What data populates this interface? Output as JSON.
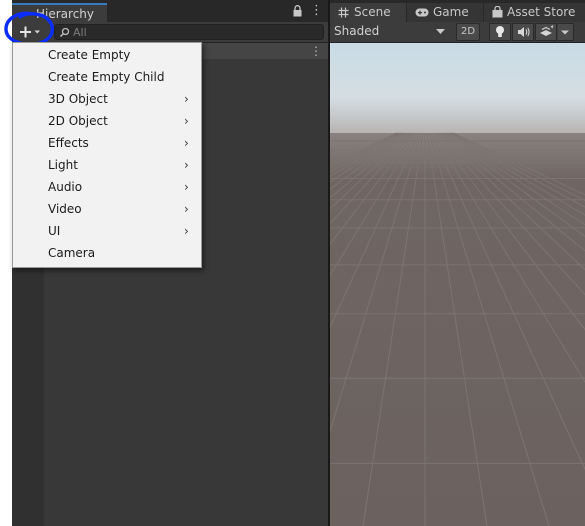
{
  "hierarchy": {
    "tab_label": "Hierarchy",
    "search_placeholder": "All"
  },
  "create_menu": {
    "items": [
      {
        "label": "Create Empty",
        "has_submenu": false
      },
      {
        "label": "Create Empty Child",
        "has_submenu": false
      },
      {
        "label": "3D Object",
        "has_submenu": true
      },
      {
        "label": "2D Object",
        "has_submenu": true
      },
      {
        "label": "Effects",
        "has_submenu": true
      },
      {
        "label": "Light",
        "has_submenu": true
      },
      {
        "label": "Audio",
        "has_submenu": true
      },
      {
        "label": "Video",
        "has_submenu": true
      },
      {
        "label": "UI",
        "has_submenu": true
      },
      {
        "label": "Camera",
        "has_submenu": false
      }
    ],
    "submenu_arrow": "›"
  },
  "scene_view": {
    "tabs": [
      {
        "label": "Scene",
        "icon": "grid-icon"
      },
      {
        "label": "Game",
        "icon": "gamepad-icon"
      },
      {
        "label": "Asset Store",
        "icon": "shopping-bag-icon"
      }
    ],
    "shading_mode": "Shaded",
    "toggle_2d_label": "2D"
  },
  "colors": {
    "annotation": "#0b2cff",
    "menu_background": "#f2f2f2",
    "panel_background": "#383838",
    "sky_top": "#c9dbe6",
    "ground": "#6b625f",
    "tab_accent": "#3a79bb"
  }
}
